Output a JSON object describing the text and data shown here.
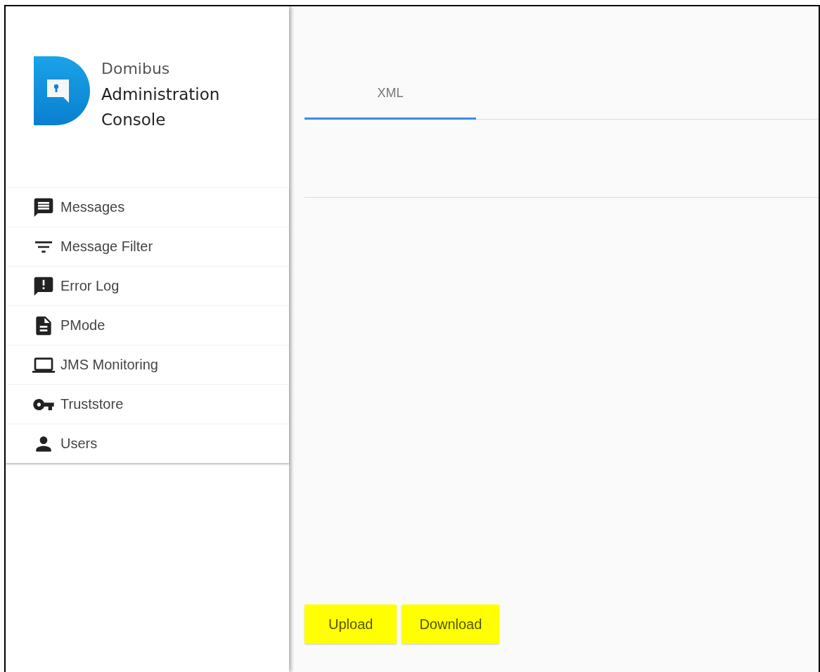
{
  "logo": {
    "line_1": "Domibus",
    "line_2": "Administration",
    "line_3": "Console"
  },
  "nav": [
    {
      "label": "Messages",
      "selected": false
    },
    {
      "label": "Message Filter",
      "selected": false
    },
    {
      "label": "Error Log",
      "selected": false
    },
    {
      "label": "PMode",
      "selected": false
    },
    {
      "label": "JMS Monitoring",
      "selected": false
    },
    {
      "label": "Truststore",
      "selected": false
    },
    {
      "label": "Users",
      "selected": false
    }
  ],
  "tabs": [
    {
      "label": "XML",
      "selected": true
    }
  ],
  "buttons": [
    "Upload",
    "Download"
  ]
}
